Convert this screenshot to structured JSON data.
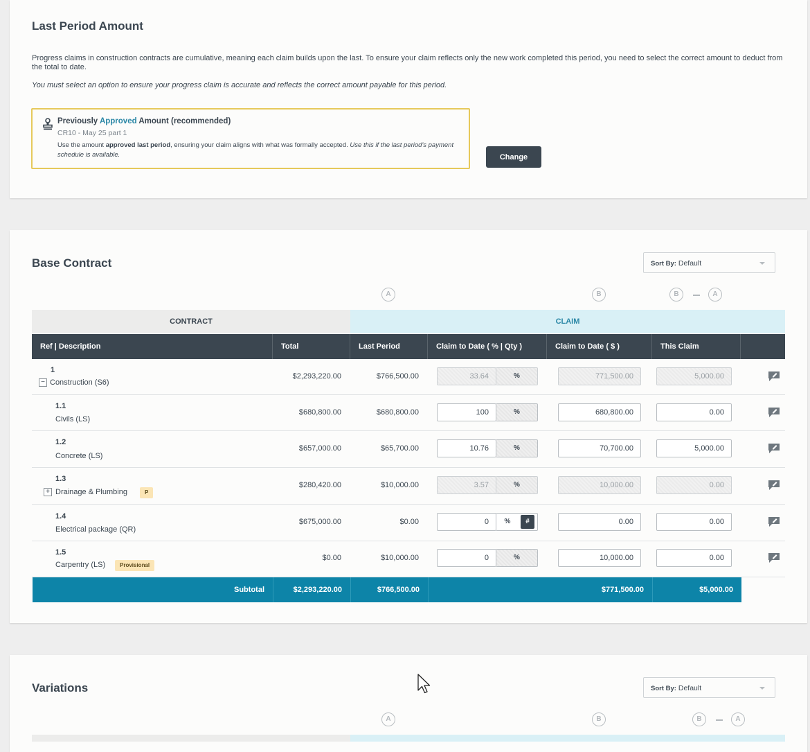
{
  "last_period_amount": {
    "title": "Last Period Amount",
    "paragraph": "Progress claims in construction contracts are cumulative, meaning each claim builds upon the last. To ensure your claim reflects only the new work completed this period, you need to select the correct amount to deduct from the total to date.",
    "instruction": "You must select an option to ensure your progress claim is accurate and reflects the correct amount payable for this period.",
    "option": {
      "title_prefix": "Previously ",
      "title_highlight": "Approved",
      "title_suffix": " Amount (recommended)",
      "subtitle": "CR10 - May 25 part 1",
      "desc_part1": "Use the amount ",
      "desc_bold": "approved last period",
      "desc_part2": ", ensuring your claim aligns with what was formally accepted. ",
      "desc_italic": "Use this if the last period's payment schedule is available."
    },
    "change_label": "Change"
  },
  "base_contract": {
    "title": "Base Contract",
    "sort_label": "Sort By:",
    "sort_value": "Default",
    "markers": {
      "a": "A",
      "b": "B"
    },
    "bands": {
      "contract": "CONTRACT",
      "claim": "CLAIM"
    },
    "columns": {
      "ref_desc": "Ref | Description",
      "total": "Total",
      "last_period": "Last Period",
      "claim_to_date_pct": "Claim to Date ( % | Qty )",
      "claim_to_date_amt": "Claim to Date ( $ )",
      "this_claim": "This Claim"
    },
    "rows": [
      {
        "ref": "1",
        "desc": "Construction (S6)",
        "total": "$2,293,220.00",
        "last_period": "$766,500.00",
        "pct": "33.64",
        "unit": "%",
        "claim_amt": "771,500.00",
        "this_claim": "5,000.00"
      },
      {
        "ref": "1.1",
        "desc": "Civils (LS)",
        "total": "$680,800.00",
        "last_period": "$680,800.00",
        "pct": "100",
        "unit": "%",
        "claim_amt": "680,800.00",
        "this_claim": "0.00"
      },
      {
        "ref": "1.2",
        "desc": "Concrete (LS)",
        "total": "$657,000.00",
        "last_period": "$65,700.00",
        "pct": "10.76",
        "unit": "%",
        "claim_amt": "70,700.00",
        "this_claim": "5,000.00"
      },
      {
        "ref": "1.3",
        "desc": "Drainage & Plumbing",
        "badge": "P",
        "total": "$280,420.00",
        "last_period": "$10,000.00",
        "pct": "3.57",
        "unit": "%",
        "claim_amt": "10,000.00",
        "this_claim": "0.00"
      },
      {
        "ref": "1.4",
        "desc": "Electrical package (QR)",
        "total": "$675,000.00",
        "last_period": "$0.00",
        "pct": "0",
        "unit": "%",
        "toggle": "#",
        "claim_amt": "0.00",
        "this_claim": "0.00"
      },
      {
        "ref": "1.5",
        "desc": "Carpentry (LS)",
        "badge": "Provisional",
        "total": "$0.00",
        "last_period": "$10,000.00",
        "pct": "0",
        "unit": "%",
        "claim_amt": "10,000.00",
        "this_claim": "0.00"
      }
    ],
    "subtotal": {
      "label": "Subtotal",
      "total": "$2,293,220.00",
      "last_period": "$766,500.00",
      "claim_amt": "$771,500.00",
      "this_claim": "$5,000.00"
    }
  },
  "variations": {
    "title": "Variations",
    "sort_label": "Sort By:",
    "sort_value": "Default",
    "markers": {
      "a": "A",
      "b": "B"
    }
  },
  "colors": {
    "primary_dark": "#3b4650",
    "accent_teal": "#0d84a8",
    "highlight_border": "#e6c95b",
    "claim_band": "#d9f0f6"
  }
}
